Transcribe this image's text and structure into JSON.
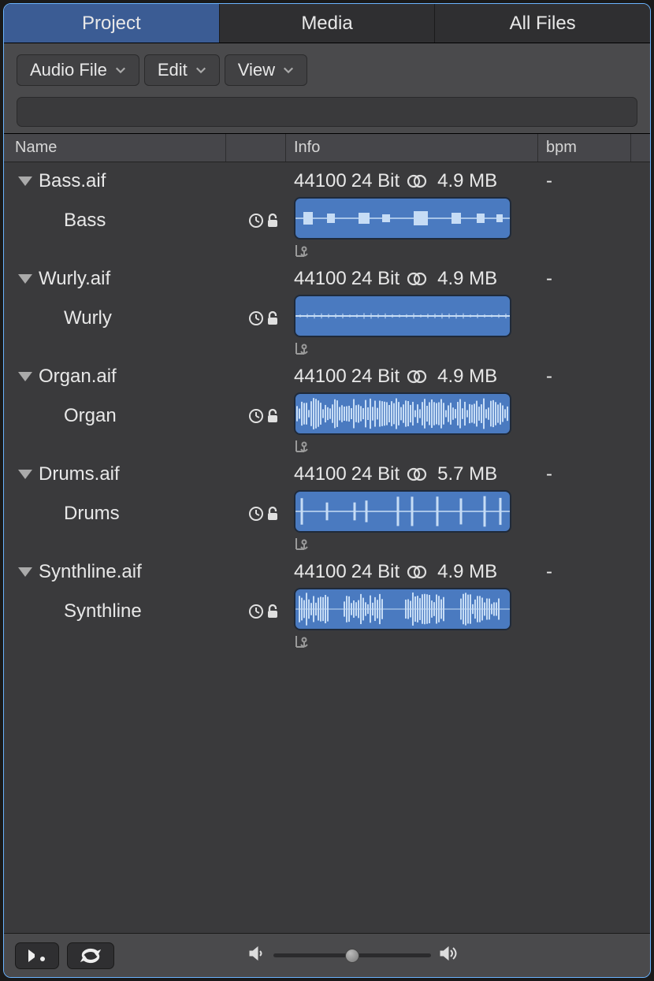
{
  "tabs": {
    "project": "Project",
    "media": "Media",
    "all_files": "All Files"
  },
  "toolbar": {
    "audio_file": "Audio File",
    "edit": "Edit",
    "view": "View",
    "search_value": ""
  },
  "columns": {
    "name": "Name",
    "info": "Info",
    "bpm": "bpm"
  },
  "files": [
    {
      "name": "Bass.aif",
      "sample_rate": "44100",
      "bit_depth": "24 Bit",
      "channels": "stereo",
      "size": "4.9 MB",
      "bpm": "-",
      "regions": [
        {
          "name": "Bass",
          "waveform": "blocks"
        }
      ]
    },
    {
      "name": "Wurly.aif",
      "sample_rate": "44100",
      "bit_depth": "24 Bit",
      "channels": "stereo",
      "size": "4.9 MB",
      "bpm": "-",
      "regions": [
        {
          "name": "Wurly",
          "waveform": "thin"
        }
      ]
    },
    {
      "name": "Organ.aif",
      "sample_rate": "44100",
      "bit_depth": "24 Bit",
      "channels": "stereo",
      "size": "4.9 MB",
      "bpm": "-",
      "regions": [
        {
          "name": "Organ",
          "waveform": "dense"
        }
      ]
    },
    {
      "name": "Drums.aif",
      "sample_rate": "44100",
      "bit_depth": "24 Bit",
      "channels": "stereo",
      "size": "5.7 MB",
      "bpm": "-",
      "regions": [
        {
          "name": "Drums",
          "waveform": "spikes"
        }
      ]
    },
    {
      "name": "Synthline.aif",
      "sample_rate": "44100",
      "bit_depth": "24 Bit",
      "channels": "stereo",
      "size": "4.9 MB",
      "bpm": "-",
      "regions": [
        {
          "name": "Synthline",
          "waveform": "bursts"
        }
      ]
    }
  ],
  "icons": {
    "chevron_down": "chevron-down-icon",
    "disclosure": "disclosure-triangle-icon",
    "clock": "clock-icon",
    "unlock": "unlock-icon",
    "stereo": "stereo-icon",
    "anchor": "anchor-icon",
    "play": "play-icon",
    "loop": "loop-icon",
    "speaker_low": "speaker-low-icon",
    "speaker_high": "speaker-high-icon"
  },
  "colors": {
    "accent": "#3b5c94",
    "waveform_bg": "#4a7ac0",
    "waveform_fg": "#c6dcf5"
  },
  "footer": {
    "volume": 0.5
  }
}
